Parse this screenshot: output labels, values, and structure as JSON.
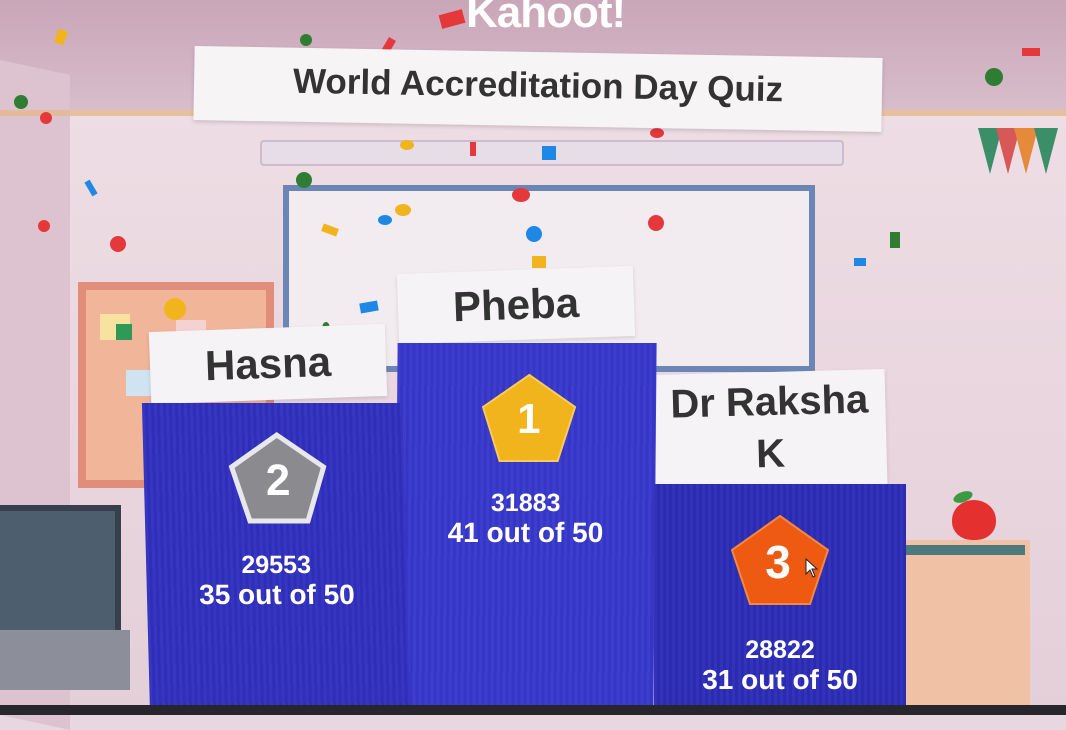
{
  "app": {
    "logo_text": "Kahoot!"
  },
  "quiz": {
    "title": "World Accreditation Day Quiz"
  },
  "podium": {
    "first": {
      "rank": "1",
      "name": "Pheba",
      "score": "31883",
      "correct": "41 out of 50",
      "badge_color": "#f2b41c",
      "badge_icon": "pentagon-badge-icon"
    },
    "second": {
      "rank": "2",
      "name": "Hasna",
      "score": "29553",
      "correct": "35 out of 50",
      "badge_color": "#8a8a8f",
      "badge_icon": "pentagon-badge-icon"
    },
    "third": {
      "rank": "3",
      "name": "Dr Raksha K",
      "score": "28822",
      "correct": "31 out of 50",
      "badge_color": "#ef5a13",
      "badge_icon": "pentagon-badge-icon"
    }
  },
  "colors": {
    "podium_blue": "#3535c8",
    "background": "#e9d7df"
  }
}
